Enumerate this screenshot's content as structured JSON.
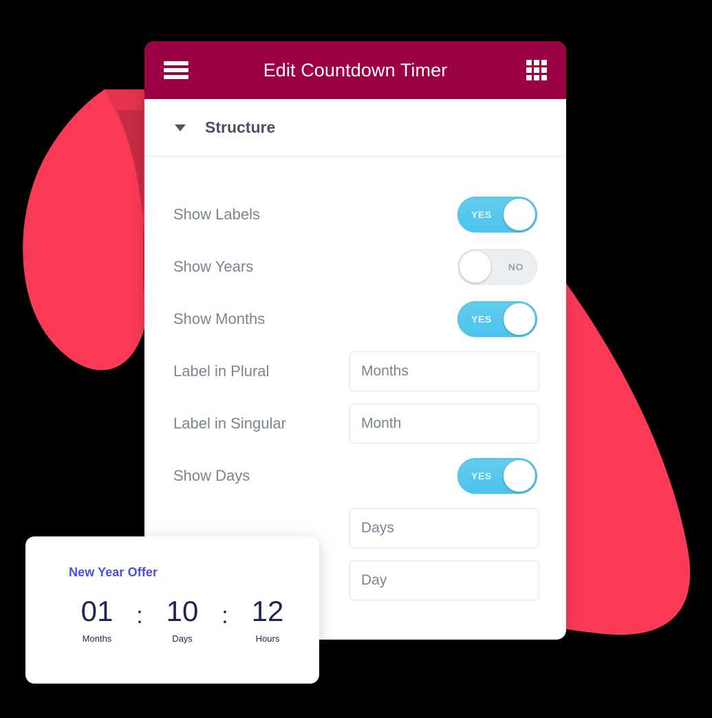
{
  "window": {
    "title": "Edit Countdown Timer",
    "menu_icon": "hamburger-icon",
    "apps_icon": "grid-icon",
    "header_color": "#9B0045"
  },
  "section": {
    "title": "Structure",
    "caret_icon": "caret-down-icon",
    "expanded": true
  },
  "rows": [
    {
      "label": "Show Labels",
      "control": "toggle",
      "value": "YES",
      "state": "on"
    },
    {
      "label": "Show Years",
      "control": "toggle",
      "value": "NO",
      "state": "off"
    },
    {
      "label": "Show Months",
      "control": "toggle",
      "value": "YES",
      "state": "on"
    },
    {
      "label": "Label in Plural",
      "control": "input",
      "value": "Months",
      "placeholder": "Months"
    },
    {
      "label": "Label in Singular",
      "control": "input",
      "value": "Month",
      "placeholder": "Month"
    },
    {
      "label": "Show Days",
      "control": "toggle",
      "value": "YES",
      "state": "on"
    },
    {
      "label": "",
      "control": "input",
      "value": "Days",
      "placeholder": "Days"
    },
    {
      "label": "",
      "control": "input",
      "value": "Day",
      "placeholder": "Day"
    }
  ],
  "preview": {
    "title": "New Year Offer",
    "title_color": "#4F4EE0",
    "digit_color": "#1E2552",
    "separator": ":",
    "units": [
      {
        "value": "01",
        "label": "Months"
      },
      {
        "value": "10",
        "label": "Days"
      },
      {
        "value": "12",
        "label": "Hours"
      }
    ]
  },
  "decor": {
    "blob_color": "#FB3A58",
    "blob_shade_1": "#E5334F",
    "blob_shade_2": "#C62B44",
    "background": "#000000"
  }
}
